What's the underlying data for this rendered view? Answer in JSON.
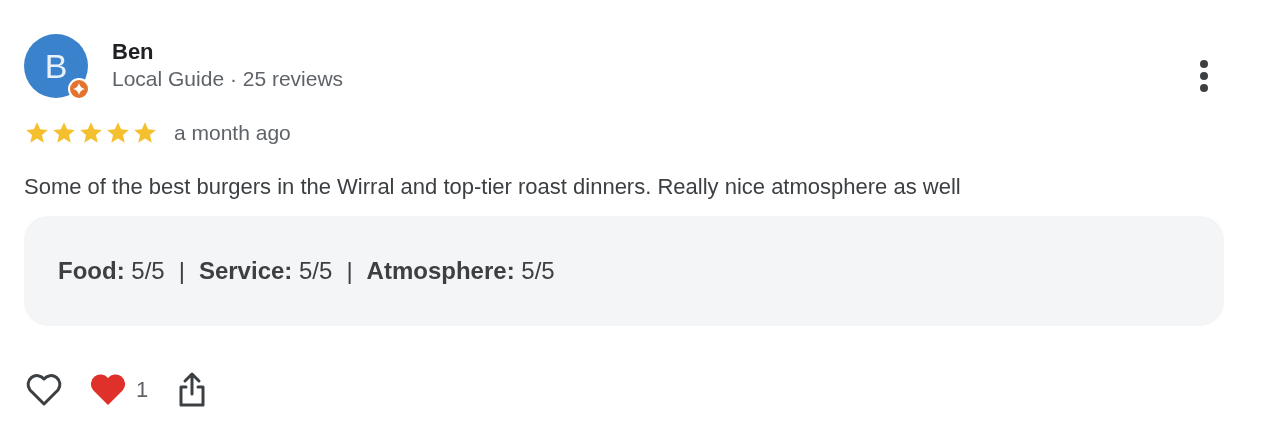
{
  "reviewer": {
    "avatar_letter": "B",
    "name": "Ben",
    "subtitle": "Local Guide · 25 reviews"
  },
  "review": {
    "stars": 5,
    "time": "a month ago",
    "text": "Some of the best burgers in the Wirral and top-tier roast dinners. Really nice atmosphere as well"
  },
  "ratings": [
    {
      "label": "Food:",
      "value": "5/5"
    },
    {
      "label": "Service:",
      "value": "5/5"
    },
    {
      "label": "Atmosphere:",
      "value": "5/5"
    }
  ],
  "separator": "|",
  "reactions": {
    "count": "1"
  }
}
